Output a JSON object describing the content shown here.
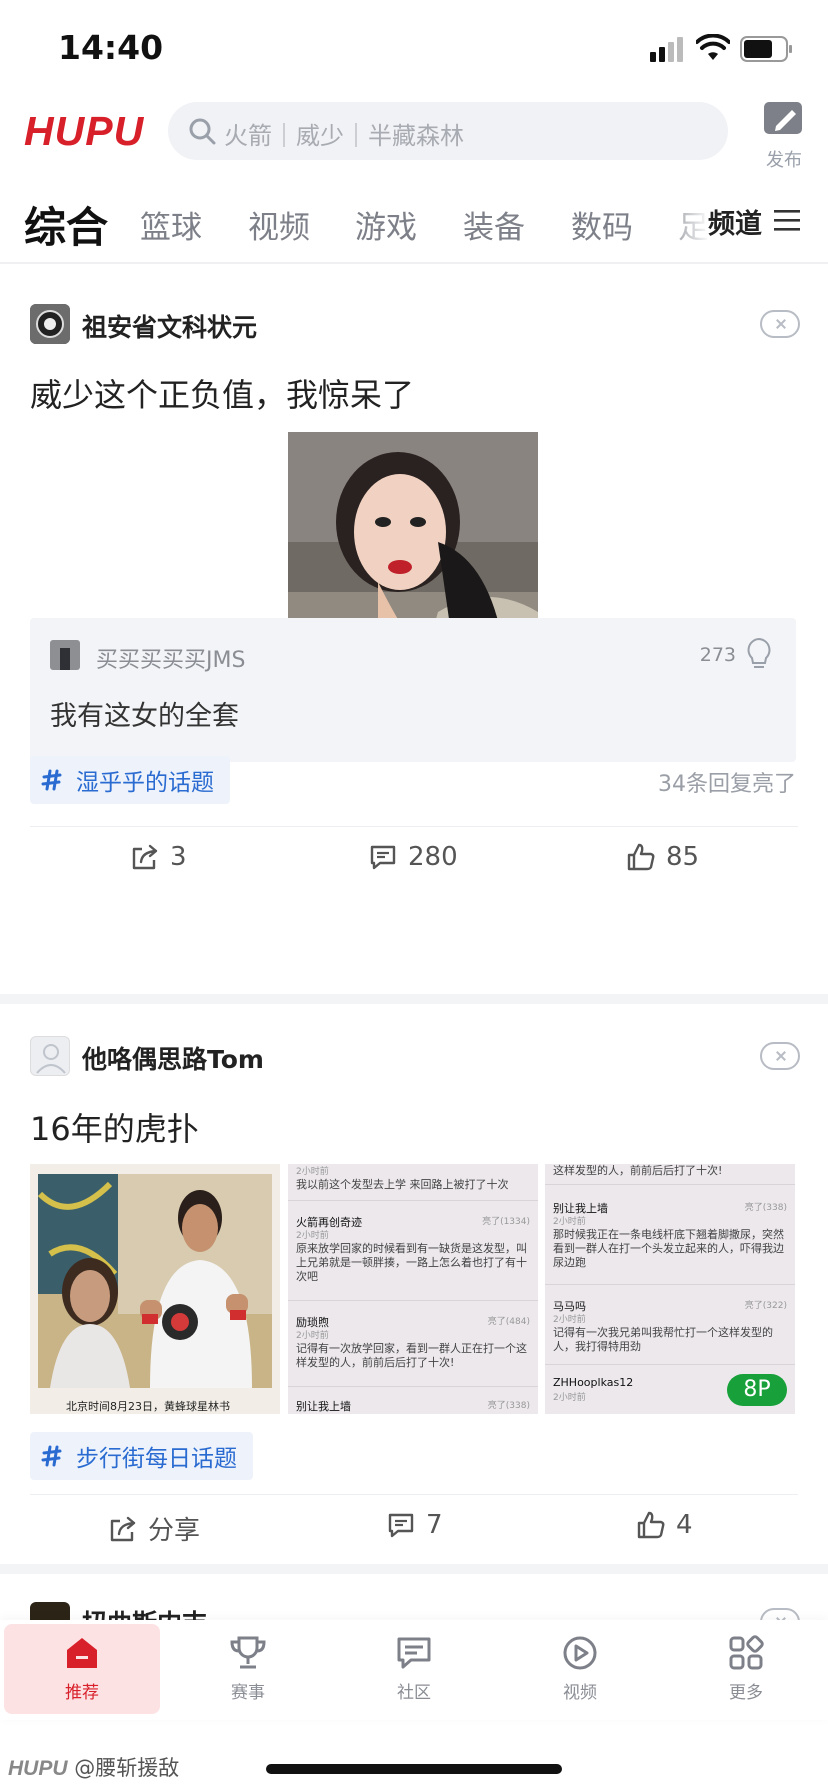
{
  "status": {
    "time": "14:40"
  },
  "header": {
    "logo": "HUPU",
    "search_placeholder": "火箭｜威少｜半藏森林",
    "publish_label": "发布"
  },
  "tabs": {
    "items": [
      "综合",
      "篮球",
      "视频",
      "游戏",
      "装备",
      "数码"
    ],
    "partial": "足",
    "active_index": 0,
    "channel_label": "频道"
  },
  "posts": [
    {
      "author": "祖安省文科状元",
      "title": "威少这个正负值，我惊呆了",
      "comment": {
        "user": "买买买买买JMS",
        "likes": "273",
        "text": "我有这女的全套"
      },
      "topic": "湿乎乎的话题",
      "replies_lit": "34条回复亮了",
      "actions": {
        "share": "3",
        "comments": "280",
        "likes": "85"
      }
    },
    {
      "author": "他咯偶思路Tom",
      "title": "16年的虎扑",
      "photo_caption": "北京时间8月23日，黄蜂球星林书",
      "thumb2": {
        "time_top": "2小时前",
        "line_top": "我以前这个发型去上学 来回路上被打了十次",
        "user1": "火箭再创奇迹",
        "lit1": "亮了(1334)",
        "time1": "2小时前",
        "text1": "原来放学回家的时候看到有一缺货是这发型，叫上兄弟就是一顿胖揍，一路上怎么着也打了有十次吧",
        "user2": "励琐煦",
        "lit2": "亮了(484)",
        "time2": "2小时前",
        "text2": "记得有一次放学回家，看到一群人正在打一个这样发型的人，前前后后打了十次!",
        "user3": "别让我上墙",
        "lit3": "亮了(338)"
      },
      "thumb3": {
        "line_top": "这样发型的人，前前后后打了十次!",
        "user1": "别让我上墙",
        "lit1": "亮了(338)",
        "time1": "2小时前",
        "text1": "那时候我正在一条电线杆底下翘着脚撒尿，突然看到一群人在打一个头发立起来的人，吓得我边尿边跑",
        "user2": "马马吗",
        "lit2": "亮了(322)",
        "time2": "2小时前",
        "text2": "记得有一次我兄弟叫我帮忙打一个这样发型的人，我打得特用劲",
        "user3": "ZHHooplkas12",
        "time3": "2小时前",
        "badge": "8P"
      },
      "topic": "步行街每日话题",
      "actions": {
        "share": "分享",
        "comments": "7",
        "likes": "4"
      }
    },
    {
      "author": "扭曲斯内吉"
    }
  ],
  "bottom_nav": [
    {
      "label": "推荐",
      "icon": "home-icon"
    },
    {
      "label": "赛事",
      "icon": "trophy-icon"
    },
    {
      "label": "社区",
      "icon": "community-icon"
    },
    {
      "label": "视频",
      "icon": "video-play-icon"
    },
    {
      "label": "更多",
      "icon": "more-grid-icon"
    }
  ],
  "watermark": {
    "logo": "HUPU",
    "handle": "@腰斩援敌"
  },
  "colors": {
    "brand": "#d8202b",
    "topic": "#2a6bd1",
    "badge": "#18a13a"
  }
}
